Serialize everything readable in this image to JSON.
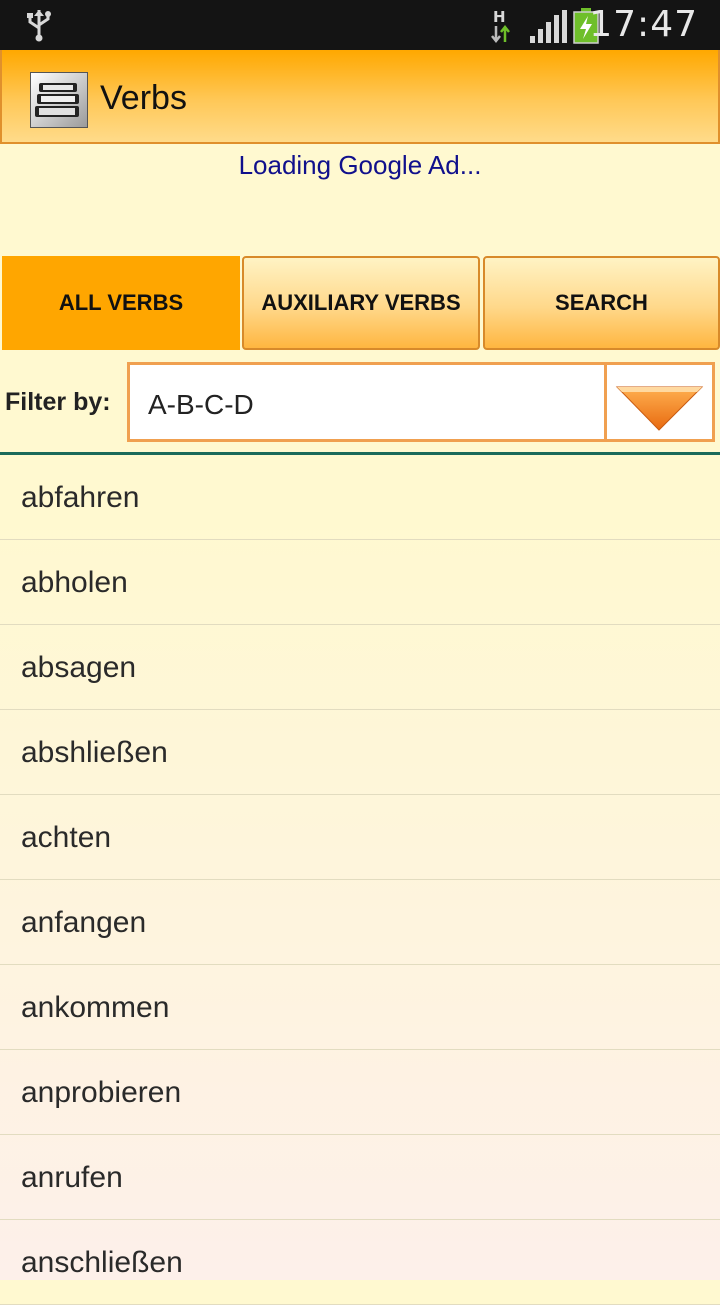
{
  "status_bar": {
    "time": "17:47",
    "network_type": "H",
    "icons": [
      "usb-icon",
      "network-h-icon",
      "signal-icon",
      "battery-charging-icon"
    ]
  },
  "app": {
    "title": "Verbs",
    "icon": "books-icon",
    "accent_color": "#ffa600"
  },
  "ad": {
    "text": "Loading Google Ad..."
  },
  "tabs": [
    {
      "label": "ALL VERBS",
      "active": true
    },
    {
      "label": "AUXILIARY VERBS",
      "active": false
    },
    {
      "label": "SEARCH",
      "active": false
    }
  ],
  "filter": {
    "label": "Filter by:",
    "value": "A-B-C-D",
    "icon": "dropdown-arrow-icon"
  },
  "verbs": [
    "abfahren",
    "abholen",
    "absagen",
    "abshließen",
    "achten",
    "anfangen",
    "ankommen",
    "anprobieren",
    "anrufen",
    "anschließen"
  ]
}
